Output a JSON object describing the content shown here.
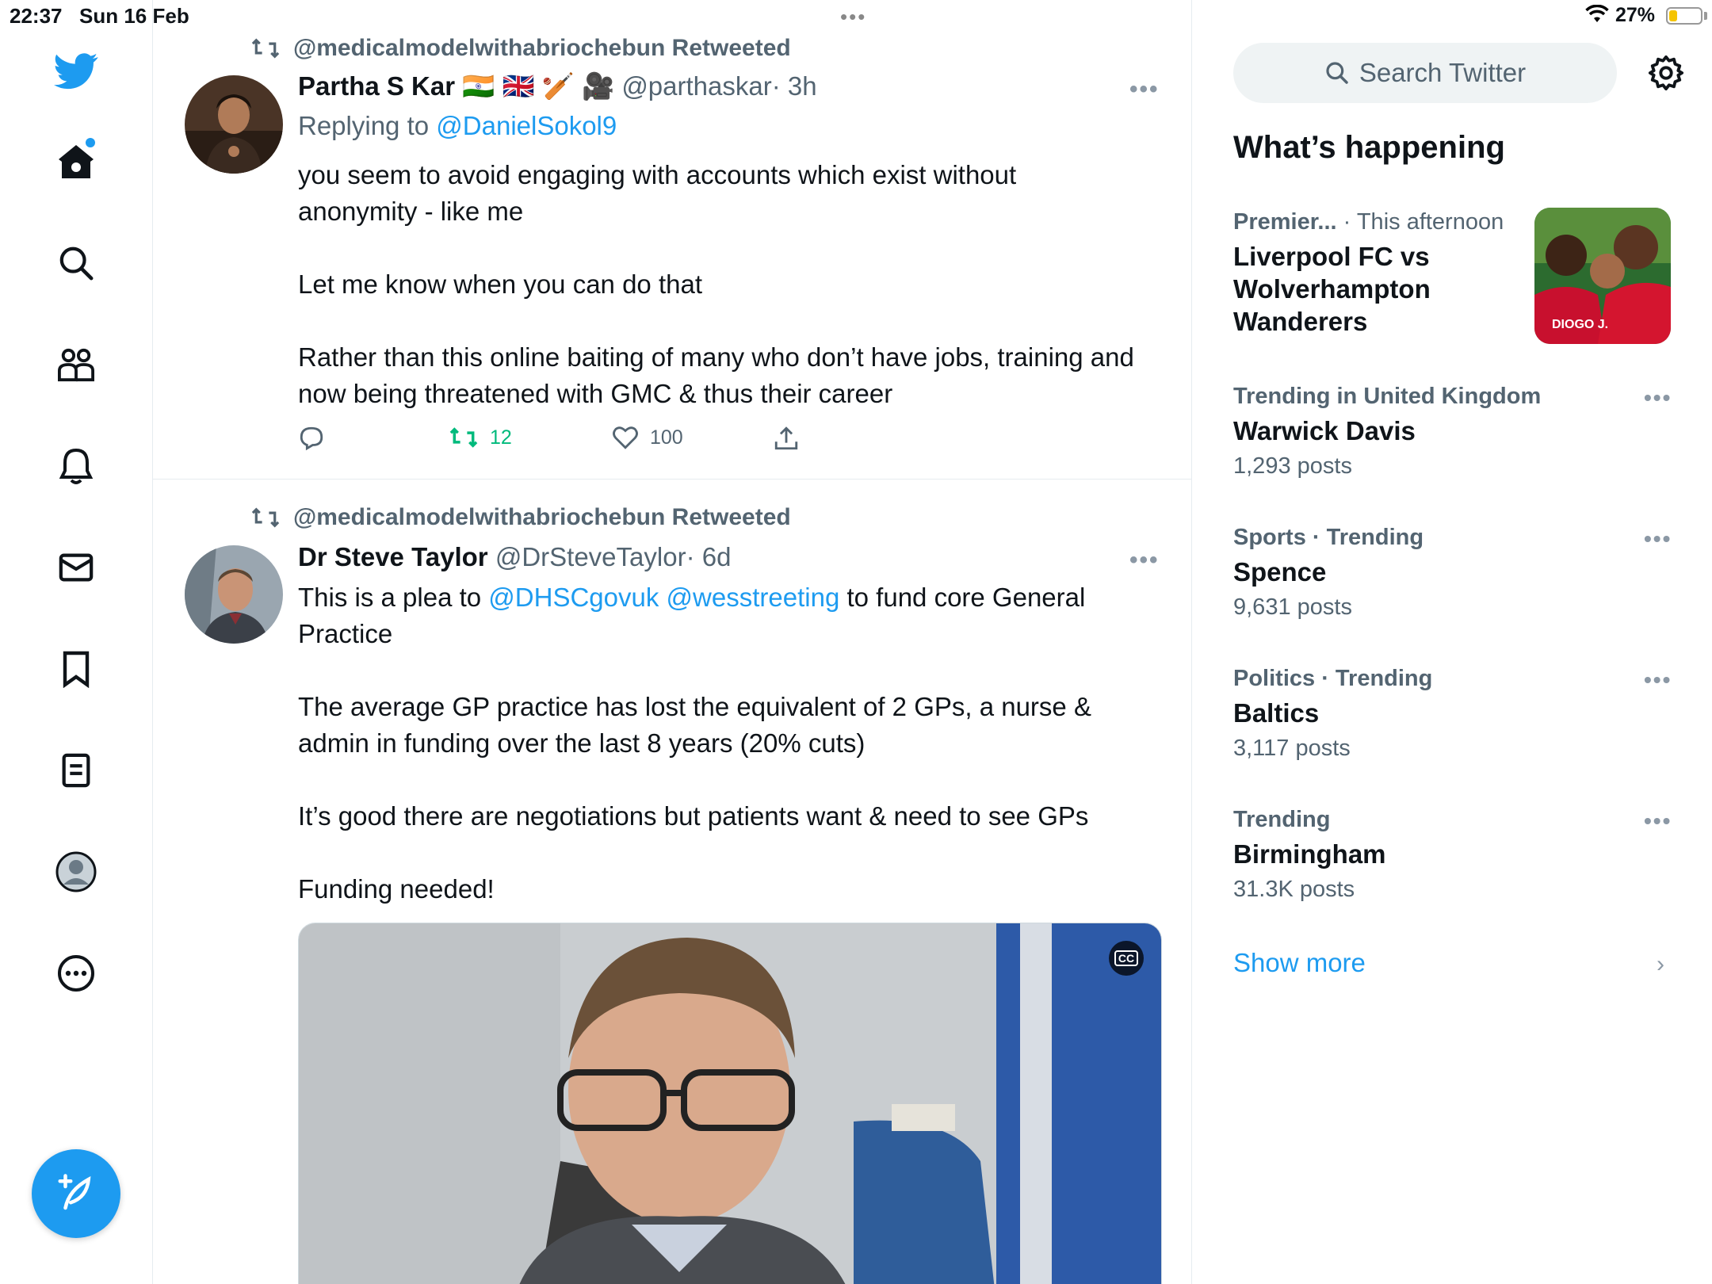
{
  "status_bar": {
    "time": "22:37",
    "date": "Sun 16 Feb",
    "battery": "27%",
    "battery_level": 0.27
  },
  "nav": {
    "icons": [
      "twitter-bird-icon",
      "home-icon",
      "search-icon",
      "communities-icon",
      "notifications-icon",
      "messages-icon",
      "bookmarks-icon",
      "lists-icon",
      "profile-icon",
      "more-icon"
    ]
  },
  "tweets": [
    {
      "retweeted_by": "@medicalmodelwithabriochebun Retweeted",
      "name": "Partha S Kar",
      "name_emoji": "🇮🇳 🇬🇧 🏏 🎥",
      "handle": "@parthaskar",
      "time": "· 3h",
      "replying_prefix": "Replying to",
      "replying_handle": "@DanielSokol9",
      "paragraphs": [
        "you seem to avoid engaging with accounts which exist without anonymity - like me",
        "Let me know when you can do that",
        "Rather than this online baiting of many who don’t have jobs, training and now being threatened with GMC & thus their career"
      ],
      "retweets": "12",
      "likes": "100"
    },
    {
      "retweeted_by": "@medicalmodelwithabriochebun Retweeted",
      "name": "Dr Steve Taylor",
      "handle": "@DrSteveTaylor",
      "time": "· 6d",
      "line1_prefix": "This is a plea to",
      "mention1": "@DHSCgovuk",
      "mention2": "@wesstreeting",
      "line1_suffix": "to fund core General Practice",
      "paragraphs": [
        "The average GP practice has lost the equivalent of 2 GPs, a nurse & admin in funding over the last 8 years (20% cuts)",
        "It’s good there are negotiations but patients want & need to see GPs",
        "Funding needed!"
      ],
      "media_cc": "CC"
    }
  ],
  "sidebar": {
    "search_placeholder": "Search Twitter",
    "title": "What’s happening",
    "featured": {
      "category": "Premier...",
      "time": "· This afternoon",
      "headline": "Liverpool FC vs Wolverhampton Wanderers",
      "image_caption": "DIOGO J."
    },
    "trends": [
      {
        "meta": "Trending in United Kingdom",
        "name": "Warwick Davis",
        "posts": "1,293 posts"
      },
      {
        "meta": "Sports · Trending",
        "name": "Spence",
        "posts": "9,631 posts"
      },
      {
        "meta": "Politics · Trending",
        "name": "Baltics",
        "posts": "3,117 posts"
      },
      {
        "meta": "Trending",
        "name": "Birmingham",
        "posts": "31.3K posts"
      }
    ],
    "show_more": "Show more"
  },
  "colors": {
    "accent": "#1d9bf0",
    "retweet_green": "#00ba7c",
    "muted": "#536471"
  }
}
